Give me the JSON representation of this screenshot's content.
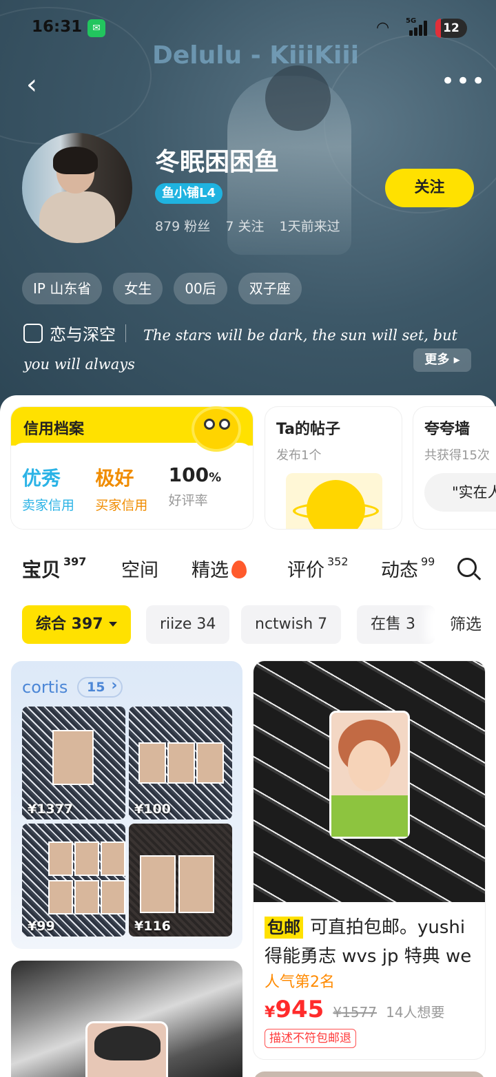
{
  "status": {
    "time": "16:31",
    "network": "5G",
    "battery": "12"
  },
  "header": {
    "music": "Delulu - KiiiKiii",
    "back_icon": "‹",
    "more_icon": "•••"
  },
  "profile": {
    "name": "冬眠困困鱼",
    "level": "鱼小铺L4",
    "followers": "879 粉丝",
    "following": "7 关注",
    "last_seen": "1天前来过",
    "follow_label": "关注",
    "tags": [
      "IP 山东省",
      "女生",
      "00后",
      "双子座"
    ],
    "game": "恋与深空",
    "motto": "The stars will be dark, the sun will set, but you will always",
    "more_label": "更多"
  },
  "credit": {
    "title": "信用档案",
    "seller_value": "优秀",
    "seller_label": "卖家信用",
    "buyer_value": "极好",
    "buyer_label": "买家信用",
    "rate_value": "100",
    "rate_unit": "%",
    "rate_label": "好评率"
  },
  "posts": {
    "title": "Ta的帖子",
    "sub": "发布1个"
  },
  "praise": {
    "title": "夸夸墙",
    "sub": "共获得15次",
    "quote": "\"实在人"
  },
  "tabs": [
    {
      "label": "宝贝",
      "count": "397"
    },
    {
      "label": "空间",
      "count": ""
    },
    {
      "label": "精选",
      "count": ""
    },
    {
      "label": "评价",
      "count": "352"
    },
    {
      "label": "动态",
      "count": "99"
    }
  ],
  "filters": {
    "active": "综合 397",
    "chips": [
      "riize 34",
      "nctwish 7",
      "在售 3"
    ],
    "filter_label": "筛选"
  },
  "collection": {
    "title": "cortis",
    "count": "15",
    "prices": [
      "¥1377",
      "¥100",
      "¥99",
      "¥116"
    ]
  },
  "product": {
    "tag": "包邮",
    "title": "可直拍包邮。yushi 得能勇志 wvs jp 特典 we",
    "rank": "人气第2名",
    "currency": "¥",
    "price": "945",
    "old_price": "¥1577",
    "want": "14人想要",
    "badge": "描述不符包邮退"
  },
  "colors": {
    "accent": "#ffe100",
    "price": "#ff2b2b",
    "link": "#4b86d6",
    "rank": "#ff8a00"
  }
}
